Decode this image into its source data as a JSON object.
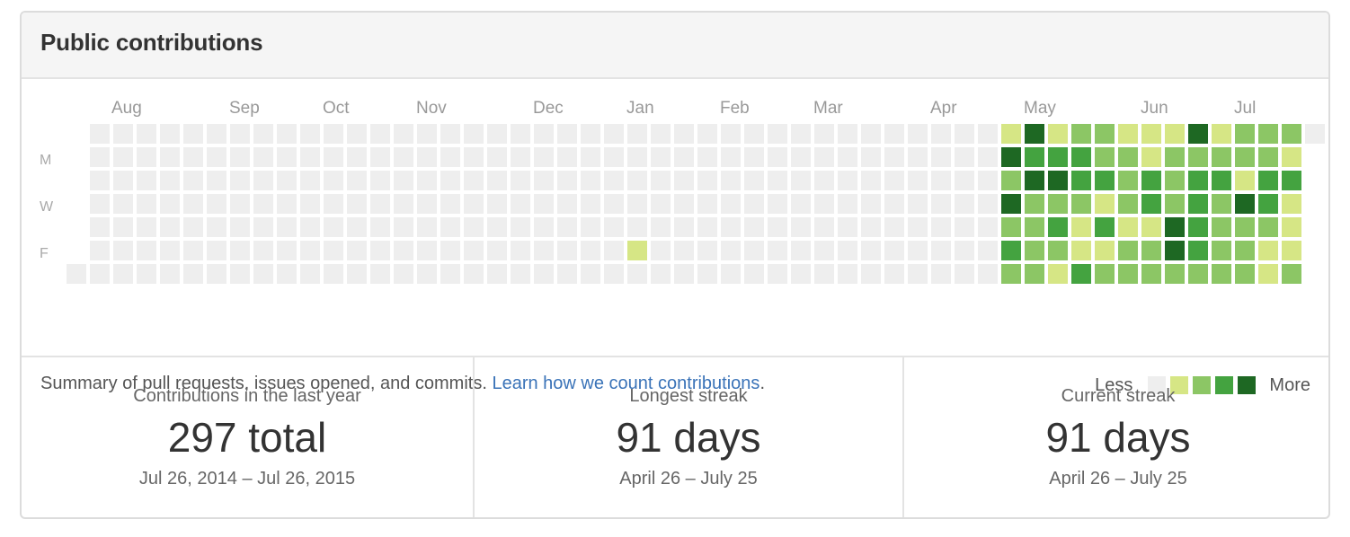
{
  "header": {
    "title": "Public contributions"
  },
  "calendar": {
    "months": [
      "Aug",
      "Sep",
      "Oct",
      "Nov",
      "Dec",
      "Jan",
      "Feb",
      "Mar",
      "Apr",
      "May",
      "Jun",
      "Jul"
    ],
    "day_labels": [
      "M",
      "W",
      "F"
    ],
    "colors": [
      "#eeeeee",
      "#d6e685",
      "#8cc665",
      "#44a340",
      "#1e6823"
    ],
    "weeks": [
      [
        null,
        null,
        null,
        null,
        null,
        null,
        0
      ],
      [
        0,
        0,
        0,
        0,
        0,
        0,
        0
      ],
      [
        0,
        0,
        0,
        0,
        0,
        0,
        0
      ],
      [
        0,
        0,
        0,
        0,
        0,
        0,
        0
      ],
      [
        0,
        0,
        0,
        0,
        0,
        0,
        0
      ],
      [
        0,
        0,
        0,
        0,
        0,
        0,
        0
      ],
      [
        0,
        0,
        0,
        0,
        0,
        0,
        0
      ],
      [
        0,
        0,
        0,
        0,
        0,
        0,
        0
      ],
      [
        0,
        0,
        0,
        0,
        0,
        0,
        0
      ],
      [
        0,
        0,
        0,
        0,
        0,
        0,
        0
      ],
      [
        0,
        0,
        0,
        0,
        0,
        0,
        0
      ],
      [
        0,
        0,
        0,
        0,
        0,
        0,
        0
      ],
      [
        0,
        0,
        0,
        0,
        0,
        0,
        0
      ],
      [
        0,
        0,
        0,
        0,
        0,
        0,
        0
      ],
      [
        0,
        0,
        0,
        0,
        0,
        0,
        0
      ],
      [
        0,
        0,
        0,
        0,
        0,
        0,
        0
      ],
      [
        0,
        0,
        0,
        0,
        0,
        0,
        0
      ],
      [
        0,
        0,
        0,
        0,
        0,
        0,
        0
      ],
      [
        0,
        0,
        0,
        0,
        0,
        0,
        0
      ],
      [
        0,
        0,
        0,
        0,
        0,
        0,
        0
      ],
      [
        0,
        0,
        0,
        0,
        0,
        0,
        0
      ],
      [
        0,
        0,
        0,
        0,
        0,
        0,
        0
      ],
      [
        0,
        0,
        0,
        0,
        0,
        0,
        0
      ],
      [
        0,
        0,
        0,
        0,
        0,
        0,
        0
      ],
      [
        0,
        0,
        0,
        0,
        0,
        1,
        0
      ],
      [
        0,
        0,
        0,
        0,
        0,
        0,
        0
      ],
      [
        0,
        0,
        0,
        0,
        0,
        0,
        0
      ],
      [
        0,
        0,
        0,
        0,
        0,
        0,
        0
      ],
      [
        0,
        0,
        0,
        0,
        0,
        0,
        0
      ],
      [
        0,
        0,
        0,
        0,
        0,
        0,
        0
      ],
      [
        0,
        0,
        0,
        0,
        0,
        0,
        0
      ],
      [
        0,
        0,
        0,
        0,
        0,
        0,
        0
      ],
      [
        0,
        0,
        0,
        0,
        0,
        0,
        0
      ],
      [
        0,
        0,
        0,
        0,
        0,
        0,
        0
      ],
      [
        0,
        0,
        0,
        0,
        0,
        0,
        0
      ],
      [
        0,
        0,
        0,
        0,
        0,
        0,
        0
      ],
      [
        0,
        0,
        0,
        0,
        0,
        0,
        0
      ],
      [
        0,
        0,
        0,
        0,
        0,
        0,
        0
      ],
      [
        0,
        0,
        0,
        0,
        0,
        0,
        0
      ],
      [
        0,
        0,
        0,
        0,
        0,
        0,
        0
      ],
      [
        1,
        4,
        2,
        4,
        2,
        3,
        2
      ],
      [
        4,
        3,
        4,
        2,
        2,
        2,
        2
      ],
      [
        1,
        3,
        4,
        2,
        3,
        2,
        1
      ],
      [
        2,
        3,
        3,
        2,
        1,
        1,
        3
      ],
      [
        2,
        2,
        3,
        1,
        3,
        1,
        2
      ],
      [
        1,
        2,
        2,
        2,
        1,
        2,
        2
      ],
      [
        1,
        1,
        3,
        3,
        1,
        2,
        2
      ],
      [
        1,
        2,
        2,
        2,
        4,
        4,
        2
      ],
      [
        4,
        2,
        3,
        3,
        3,
        3,
        2
      ],
      [
        1,
        2,
        3,
        2,
        2,
        2,
        2
      ],
      [
        2,
        2,
        1,
        4,
        2,
        2,
        2
      ],
      [
        2,
        2,
        3,
        3,
        2,
        1,
        1
      ],
      [
        2,
        1,
        3,
        1,
        1,
        1,
        2
      ],
      [
        0,
        null,
        null,
        null,
        null,
        null,
        null
      ]
    ]
  },
  "summary": {
    "text": "Summary of pull requests, issues opened, and commits.",
    "link": "Learn how we count contributions",
    "period": "."
  },
  "legend": {
    "less": "Less",
    "more": "More"
  },
  "stats": [
    {
      "label": "Contributions in the last year",
      "value": "297 total",
      "range": "Jul 26, 2014 – Jul 26, 2015"
    },
    {
      "label": "Longest streak",
      "value": "91 days",
      "range": "April 26 – July 25"
    },
    {
      "label": "Current streak",
      "value": "91 days",
      "range": "April 26 – July 25"
    }
  ]
}
